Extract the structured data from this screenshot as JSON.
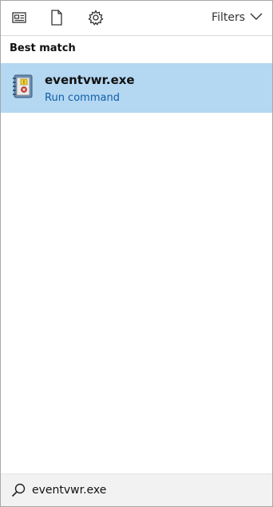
{
  "toolbar": {
    "icons": [
      "apps-icon",
      "document-icon",
      "settings-gear-icon"
    ],
    "filters_label": "Filters"
  },
  "section": {
    "title": "Best match"
  },
  "best_match": {
    "name": "eventvwr.exe",
    "type": "Run command",
    "icon": "event-viewer-icon"
  },
  "search": {
    "value": "eventvwr.exe",
    "icon": "search-icon"
  },
  "colors": {
    "selection_bg": "#b4d7f2",
    "link_blue": "#0f5fa8",
    "search_bg": "#f2f2f2"
  }
}
